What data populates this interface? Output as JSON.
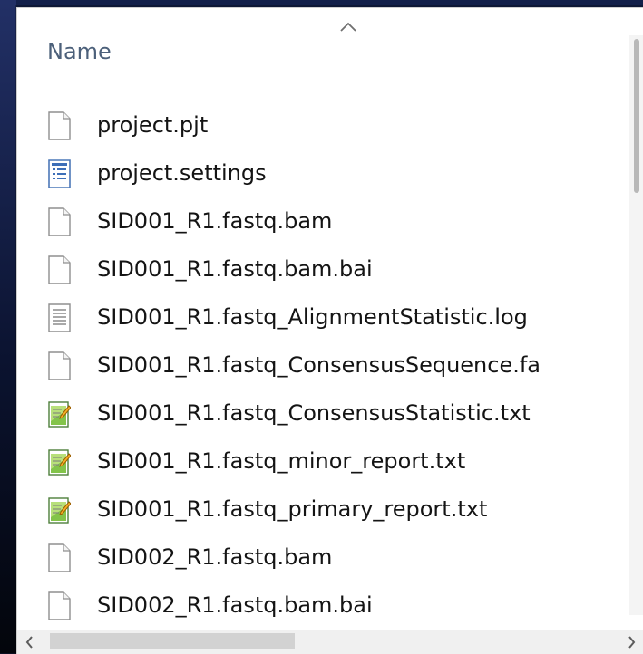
{
  "header": {
    "column_name": "Name",
    "sort_icon": "chevron-up-icon"
  },
  "files": [
    {
      "name": "project.pjt",
      "icon": "blank-file-icon"
    },
    {
      "name": "project.settings",
      "icon": "settings-file-icon"
    },
    {
      "name": "SID001_R1.fastq.bam",
      "icon": "blank-file-icon"
    },
    {
      "name": "SID001_R1.fastq.bam.bai",
      "icon": "blank-file-icon"
    },
    {
      "name": "SID001_R1.fastq_AlignmentStatistic.log",
      "icon": "log-file-icon"
    },
    {
      "name": "SID001_R1.fastq_ConsensusSequence.fa",
      "icon": "blank-file-icon"
    },
    {
      "name": "SID001_R1.fastq_ConsensusStatistic.txt",
      "icon": "text-file-icon"
    },
    {
      "name": "SID001_R1.fastq_minor_report.txt",
      "icon": "text-file-icon"
    },
    {
      "name": "SID001_R1.fastq_primary_report.txt",
      "icon": "text-file-icon"
    },
    {
      "name": "SID002_R1.fastq.bam",
      "icon": "blank-file-icon"
    },
    {
      "name": "SID002_R1.fastq.bam.bai",
      "icon": "blank-file-icon"
    }
  ],
  "scrollbar": {
    "left_icon": "chevron-left-icon",
    "right_icon": "chevron-right-icon"
  }
}
